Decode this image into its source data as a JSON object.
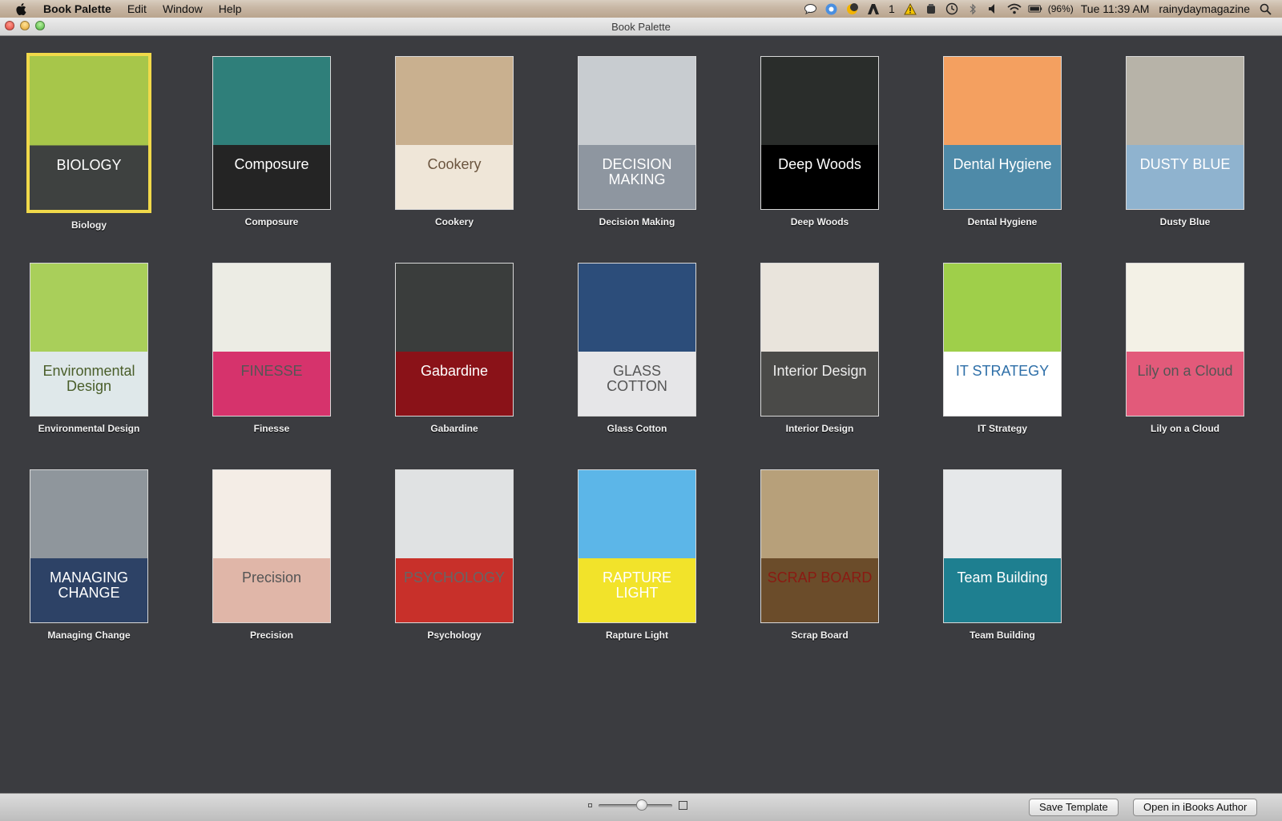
{
  "menubar": {
    "app_name": "Book Palette",
    "menus": [
      "Edit",
      "Window",
      "Help"
    ],
    "status": {
      "adobe_count": "1",
      "battery": "(96%)",
      "clock": "Tue 11:39 AM",
      "user": "rainydaymagazine"
    }
  },
  "window": {
    "title": "Book Palette"
  },
  "templates": [
    {
      "label": "Biology",
      "cover_text": "BIOLOGY",
      "bg": "#a7c64a",
      "fg": "#ffffff",
      "accent": "#3e4140",
      "selected": true
    },
    {
      "label": "Composure",
      "cover_text": "Composure",
      "bg": "#2f7f7a",
      "fg": "#ffffff",
      "accent": "#242424"
    },
    {
      "label": "Cookery",
      "cover_text": "Cookery",
      "bg": "#c9b08f",
      "fg": "#6b553f",
      "accent": "#efe6d8"
    },
    {
      "label": "Decision Making",
      "cover_text": "DECISION MAKING",
      "bg": "#c8ccd0",
      "fg": "#ffffff",
      "accent": "#8e96a0"
    },
    {
      "label": "Deep Woods",
      "cover_text": "Deep Woods",
      "bg": "#2a2d2b",
      "fg": "#ffffff",
      "accent": "#000000"
    },
    {
      "label": "Dental Hygiene",
      "cover_text": "Dental Hygiene",
      "bg": "#f4a060",
      "fg": "#ffffff",
      "accent": "#4e8aa8"
    },
    {
      "label": "Dusty Blue",
      "cover_text": "DUSTY BLUE",
      "bg": "#b7b3a8",
      "fg": "#ffffff",
      "accent": "#8fb3cf"
    },
    {
      "label": "Environmental Design",
      "cover_text": "Environmental Design",
      "bg": "#a9cf5a",
      "fg": "#4a5e2a",
      "accent": "#dfe8ea"
    },
    {
      "label": "Finesse",
      "cover_text": "FINESSE",
      "bg": "#ecece4",
      "fg": "#555555",
      "accent": "#d6336c"
    },
    {
      "label": "Gabardine",
      "cover_text": "Gabardine",
      "bg": "#3a3d3c",
      "fg": "#ffffff",
      "accent": "#8a1218"
    },
    {
      "label": "Glass Cotton",
      "cover_text": "GLASS COTTON",
      "bg": "#2c4d7a",
      "fg": "#555555",
      "accent": "#e6e6e8"
    },
    {
      "label": "Interior Design",
      "cover_text": "Interior Design",
      "bg": "#e9e4dc",
      "fg": "#eeeeee",
      "accent": "#4a4a48"
    },
    {
      "label": "IT Strategy",
      "cover_text": "IT STRATEGY",
      "bg": "#9fcf4a",
      "fg": "#2e6fa8",
      "accent": "#ffffff"
    },
    {
      "label": "Lily on a Cloud",
      "cover_text": "Lily on a Cloud",
      "bg": "#f3f1e6",
      "fg": "#555555",
      "accent": "#e25a7a"
    },
    {
      "label": "Managing Change",
      "cover_text": "MANAGING CHANGE",
      "bg": "#8f969c",
      "fg": "#ffffff",
      "accent": "#2d4266"
    },
    {
      "label": "Precision",
      "cover_text": "Precision",
      "bg": "#f4ede6",
      "fg": "#555555",
      "accent": "#e0b6a8"
    },
    {
      "label": "Psychology",
      "cover_text": "PSYCHOLOGY",
      "bg": "#e0e2e3",
      "fg": "#666666",
      "accent": "#c8302a"
    },
    {
      "label": "Rapture Light",
      "cover_text": "RAPTURE LIGHT",
      "bg": "#5cb6e8",
      "fg": "#ffffff",
      "accent": "#f2e32a"
    },
    {
      "label": "Scrap Board",
      "cover_text": "SCRAP BOARD",
      "bg": "#b7a07a",
      "fg": "#8a1a12",
      "accent": "#6b4c2a"
    },
    {
      "label": "Team Building",
      "cover_text": "Team Building",
      "bg": "#e6e8ea",
      "fg": "#ffffff",
      "accent": "#1e7f90"
    }
  ],
  "footer": {
    "save_template": "Save Template",
    "open_in_ibooks": "Open in iBooks Author",
    "zoom_level": 0.6
  },
  "colors": {
    "content_bg": "#3b3c40",
    "selection": "#f1d94a"
  }
}
